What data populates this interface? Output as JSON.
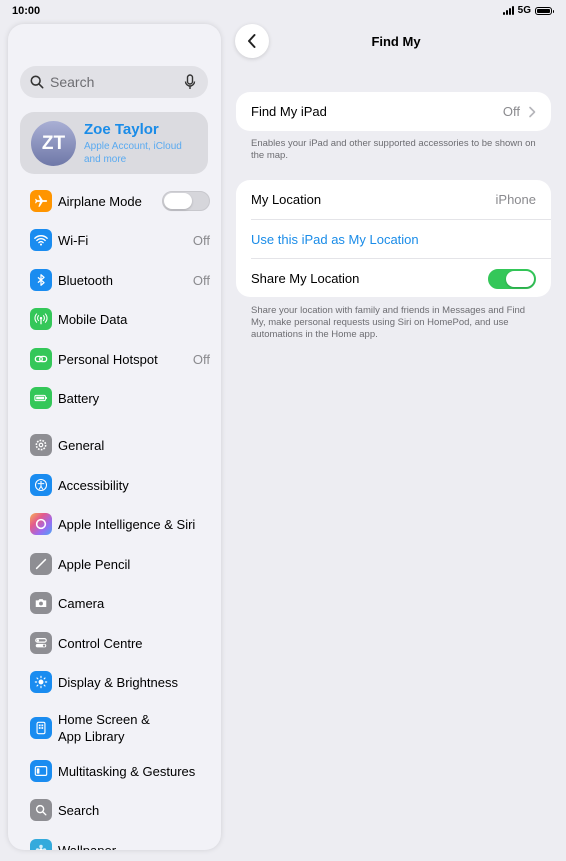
{
  "status": {
    "time": "10:00",
    "network": "5G"
  },
  "sidebar": {
    "search_placeholder": "Search",
    "profile": {
      "initials": "ZT",
      "name": "Zoe Taylor",
      "subtitle": "Apple Account, iCloud and more"
    },
    "items": [
      {
        "label": "Airplane Mode",
        "value": "",
        "icon": "airplane-icon",
        "color": "#ff9500",
        "toggle": "off"
      },
      {
        "label": "Wi-Fi",
        "value": "Off",
        "icon": "wifi-icon",
        "color": "#1a8cf0"
      },
      {
        "label": "Bluetooth",
        "value": "Off",
        "icon": "bluetooth-icon",
        "color": "#1a8cf0"
      },
      {
        "label": "Mobile Data",
        "value": "",
        "icon": "antenna-icon",
        "color": "#34c759"
      },
      {
        "label": "Personal Hotspot",
        "value": "Off",
        "icon": "link-icon",
        "color": "#34c759"
      },
      {
        "label": "Battery",
        "value": "",
        "icon": "battery-icon",
        "color": "#34c759"
      },
      {
        "label": "General",
        "value": "",
        "icon": "gear-icon",
        "color": "#8e8e93"
      },
      {
        "label": "Accessibility",
        "value": "",
        "icon": "accessibility-icon",
        "color": "#1a8cf0"
      },
      {
        "label": "Apple Intelligence & Siri",
        "value": "",
        "icon": "siri-icon",
        "color": "#d66de8"
      },
      {
        "label": "Apple Pencil",
        "value": "",
        "icon": "pencil-icon",
        "color": "#8e8e93"
      },
      {
        "label": "Camera",
        "value": "",
        "icon": "camera-icon",
        "color": "#8e8e93"
      },
      {
        "label": "Control Centre",
        "value": "",
        "icon": "control-centre-icon",
        "color": "#8e8e93"
      },
      {
        "label": "Display & Brightness",
        "value": "",
        "icon": "sun-icon",
        "color": "#1a8cf0"
      },
      {
        "label": "Home Screen &\nApp Library",
        "value": "",
        "icon": "home-screen-icon",
        "color": "#1a8cf0"
      },
      {
        "label": "Multitasking & Gestures",
        "value": "",
        "icon": "multitasking-icon",
        "color": "#1a8cf0"
      },
      {
        "label": "Search",
        "value": "",
        "icon": "search-icon",
        "color": "#8e8e93"
      },
      {
        "label": "Wallpaper",
        "value": "",
        "icon": "wallpaper-icon",
        "color": "#34aadc"
      }
    ]
  },
  "main": {
    "title": "Find My",
    "find_my_ipad": {
      "label": "Find My iPad",
      "value": "Off"
    },
    "find_my_note": "Enables your iPad and other supported accessories to be shown on the map.",
    "my_location": {
      "label": "My Location",
      "value": "iPhone"
    },
    "use_ipad_link": "Use this iPad as My Location",
    "share_location": {
      "label": "Share My Location",
      "toggle": "on"
    },
    "share_note": "Share your location with family and friends in Messages and Find My, make personal requests using Siri on HomePod, and use automations in the Home app."
  }
}
